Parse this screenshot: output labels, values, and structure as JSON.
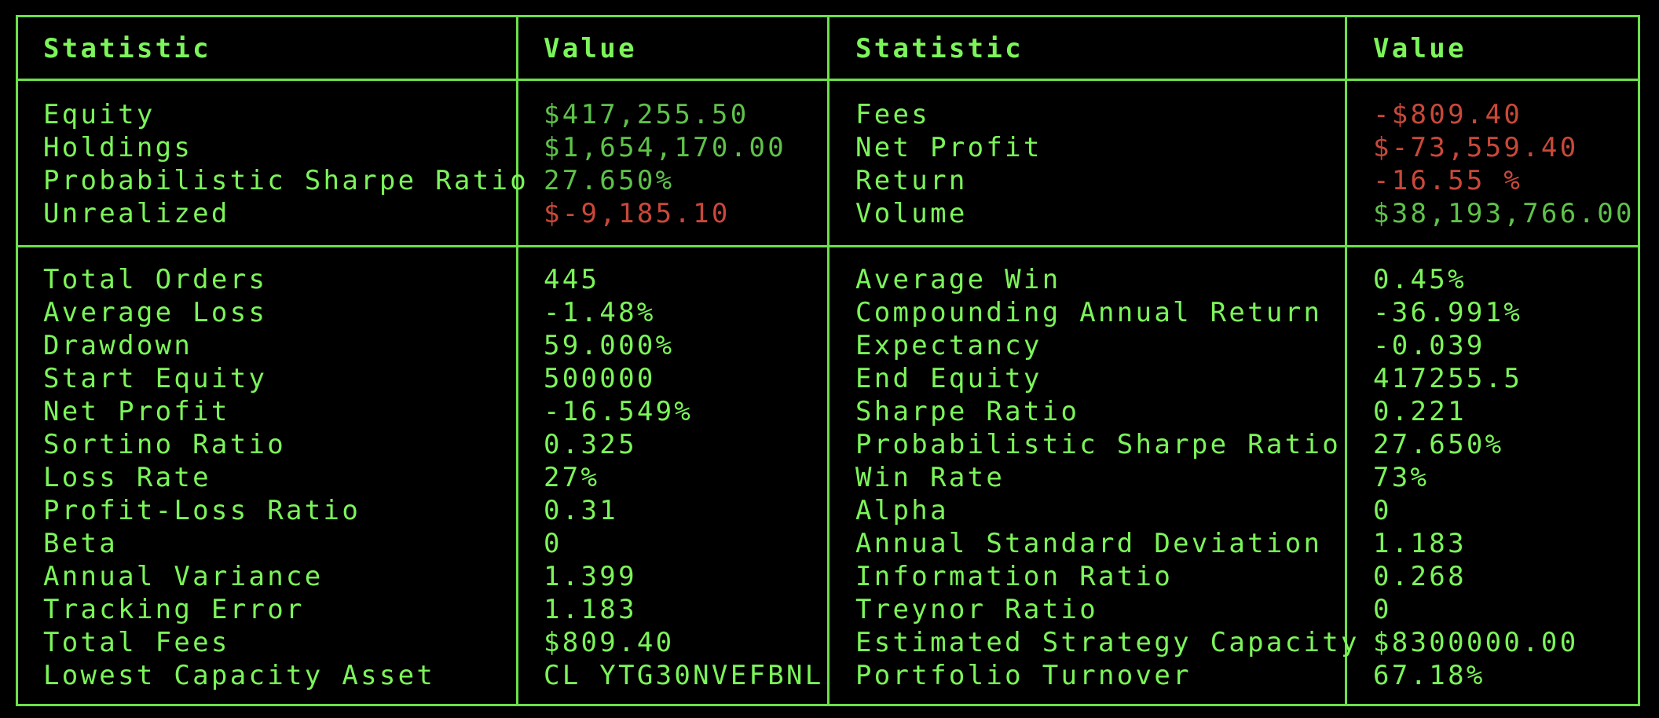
{
  "headers": {
    "col1": "Statistic",
    "col2": "Value",
    "col3": "Statistic",
    "col4": "Value"
  },
  "summary_left": [
    {
      "label": "Equity",
      "value": "$417,255.50",
      "tone": "positive"
    },
    {
      "label": "Holdings",
      "value": "$1,654,170.00",
      "tone": "positive"
    },
    {
      "label": "Probabilistic Sharpe Ratio",
      "value": "27.650%",
      "tone": "positive"
    },
    {
      "label": "Unrealized",
      "value": "$-9,185.10",
      "tone": "negative"
    }
  ],
  "summary_right": [
    {
      "label": "Fees",
      "value": "-$809.40",
      "tone": "negative"
    },
    {
      "label": "Net Profit",
      "value": "$-73,559.40",
      "tone": "negative"
    },
    {
      "label": "Return",
      "value": "-16.55 %",
      "tone": "negative"
    },
    {
      "label": "Volume",
      "value": "$38,193,766.00",
      "tone": "positive"
    }
  ],
  "stats_left": [
    {
      "label": "Total Orders",
      "value": "445"
    },
    {
      "label": "Average Loss",
      "value": "-1.48%"
    },
    {
      "label": "Drawdown",
      "value": "59.000%"
    },
    {
      "label": "Start Equity",
      "value": "500000"
    },
    {
      "label": "Net Profit",
      "value": "-16.549%"
    },
    {
      "label": "Sortino Ratio",
      "value": "0.325"
    },
    {
      "label": "Loss Rate",
      "value": "27%"
    },
    {
      "label": "Profit-Loss Ratio",
      "value": "0.31"
    },
    {
      "label": "Beta",
      "value": "0"
    },
    {
      "label": "Annual Variance",
      "value": "1.399"
    },
    {
      "label": "Tracking Error",
      "value": "1.183"
    },
    {
      "label": "Total Fees",
      "value": "$809.40"
    },
    {
      "label": "Lowest Capacity Asset",
      "value": "CL YTG30NVEFBNL"
    }
  ],
  "stats_right": [
    {
      "label": "Average Win",
      "value": "0.45%"
    },
    {
      "label": "Compounding Annual Return",
      "value": "-36.991%"
    },
    {
      "label": "Expectancy",
      "value": "-0.039"
    },
    {
      "label": "End Equity",
      "value": "417255.5"
    },
    {
      "label": "Sharpe Ratio",
      "value": "0.221"
    },
    {
      "label": "Probabilistic Sharpe Ratio",
      "value": "27.650%"
    },
    {
      "label": "Win Rate",
      "value": "73%"
    },
    {
      "label": "Alpha",
      "value": "0"
    },
    {
      "label": "Annual Standard Deviation",
      "value": "1.183"
    },
    {
      "label": "Information Ratio",
      "value": "0.268"
    },
    {
      "label": "Treynor Ratio",
      "value": "0"
    },
    {
      "label": "Estimated Strategy Capacity",
      "value": "$8300000.00"
    },
    {
      "label": "Portfolio Turnover",
      "value": "67.18%"
    }
  ],
  "colors": {
    "border": "#6be04a",
    "text": "#7cf55a",
    "positive": "#5fc24a",
    "negative": "#c9483a",
    "background": "#000000"
  }
}
